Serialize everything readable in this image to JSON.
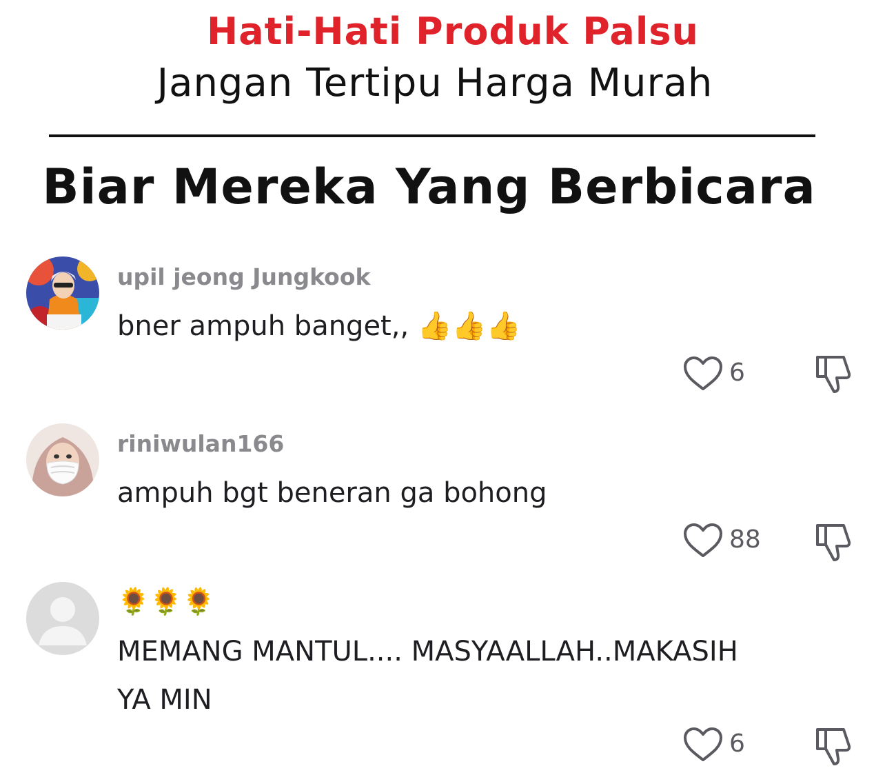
{
  "header": {
    "headline_red": "Hati-Hati Produk Palsu",
    "headline_black": "Jangan Tertipu Harga Murah",
    "section_title": "Biar Mereka Yang Berbicara"
  },
  "comments": [
    {
      "username": "upil jeong Jungkook",
      "text": "bner ampuh banget,, 👍👍👍",
      "likes": "6",
      "avatar_icon": "profile-photo-orange-jacket"
    },
    {
      "username": "riniwulan166",
      "text": "ampuh bgt beneran ga bohong",
      "likes": "88",
      "avatar_icon": "profile-photo-hijab-mask"
    },
    {
      "username": "🌻🌻🌻",
      "text_line1": "MEMANG MANTUL.... MASYAALLAH..MAKASIH",
      "text_line2": "YA MIN",
      "likes": "6",
      "avatar_icon": "default-avatar-icon"
    }
  ],
  "icons": {
    "like": "heart-outline-icon",
    "dislike": "thumbs-down-outline-icon"
  },
  "colors": {
    "headline_red": "#e0222b",
    "username_gray": "#8a8a8e",
    "text_dark": "#1e1e22",
    "icon_gray": "#5a5a60"
  }
}
